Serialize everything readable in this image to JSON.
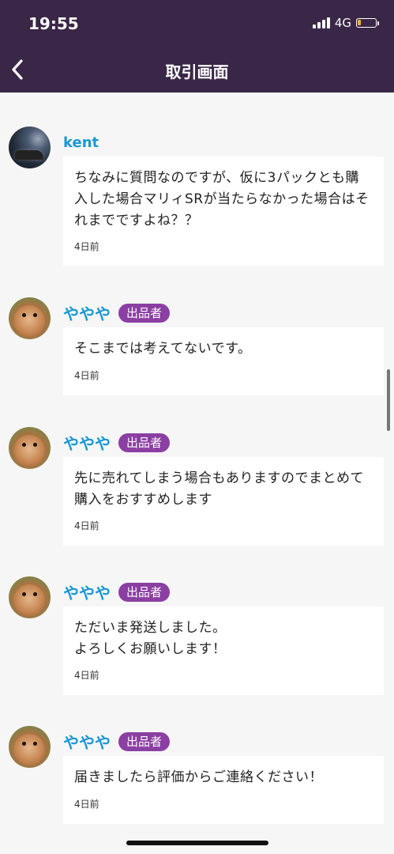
{
  "status_bar": {
    "time": "19:55",
    "network": "4G",
    "battery_color": "#f2b133"
  },
  "nav": {
    "title": "取引画面",
    "back_icon": "chevron-left-icon",
    "bar_color": "#3a2747"
  },
  "messages": [
    {
      "user": "kent",
      "is_seller": false,
      "text": "ちなみに質問なのですが、仮に3パックとも購入した場合マリィSRが当たらなかった場合はそれまでですよね？？",
      "time": "4日前"
    },
    {
      "user": "ややや",
      "is_seller": true,
      "badge": "出品者",
      "text": "そこまでは考えてないです。",
      "time": "4日前"
    },
    {
      "user": "ややや",
      "is_seller": true,
      "badge": "出品者",
      "text": "先に売れてしまう場合もありますのでまとめて購入をおすすめします",
      "time": "4日前"
    },
    {
      "user": "ややや",
      "is_seller": true,
      "badge": "出品者",
      "text": "ただいま発送しました。\nよろしくお願いします！",
      "time": "4日前"
    },
    {
      "user": "ややや",
      "is_seller": true,
      "badge": "出品者",
      "text": "届きましたら評価からご連絡ください！",
      "time": "4日前"
    }
  ],
  "colors": {
    "username": "#1a98d5",
    "badge": "#8b3fa2",
    "background": "#f6f6f6"
  }
}
